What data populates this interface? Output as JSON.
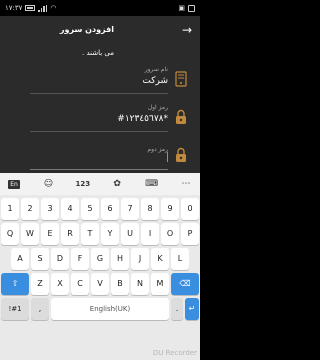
{
  "status_bar": {
    "time": "١٧:٣٧"
  },
  "app_bar": {
    "title": "افزودن سرور"
  },
  "form": {
    "hint": "می باشند .",
    "server_name": {
      "label": "نام سرور",
      "value": "شرکت"
    },
    "password1": {
      "label": "رمز اول",
      "value": "*١٢٣٤٥٦٧٨#"
    },
    "password2": {
      "placeholder": "رمز دوم"
    }
  },
  "keyboard_toolbar": {
    "lang": "En",
    "numbers": "123"
  },
  "keyboard": {
    "row_numbers": [
      "1",
      "2",
      "3",
      "4",
      "5",
      "6",
      "7",
      "8",
      "9",
      "0"
    ],
    "row_q": [
      "Q",
      "W",
      "E",
      "R",
      "T",
      "Y",
      "U",
      "I",
      "O",
      "P"
    ],
    "row_a": [
      "A",
      "S",
      "D",
      "F",
      "G",
      "H",
      "J",
      "K",
      "L"
    ],
    "row_z": [
      "Z",
      "X",
      "C",
      "V",
      "B",
      "N",
      "M"
    ],
    "bottom": {
      "sym": "!#1",
      "comma": ",",
      "space": "English(UK)",
      "period": "."
    }
  },
  "watermark": "DU Recorder",
  "colors": {
    "app_bg": "#2b2b2b",
    "accent": "#c08a3e",
    "key_blue": "#3a8ee0"
  }
}
